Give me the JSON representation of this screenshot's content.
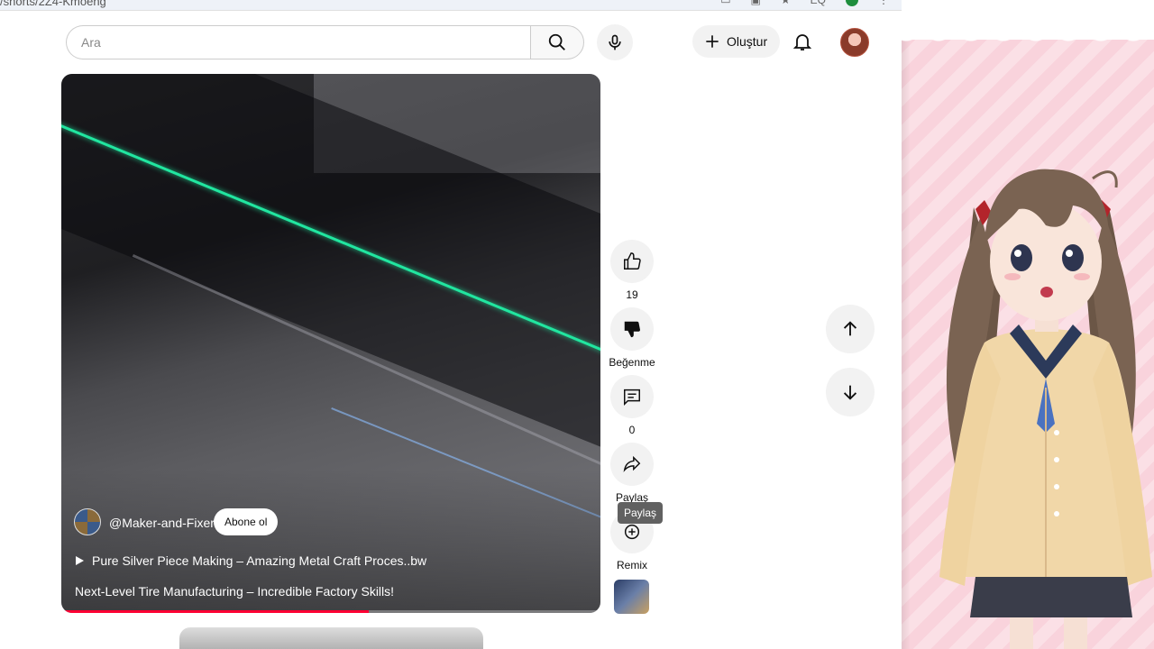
{
  "browser": {
    "url_fragment": "/shorts/2Z4-Kmoeng"
  },
  "header": {
    "search_placeholder": "Ara",
    "create_label": "Oluştur",
    "icons": [
      "search-icon",
      "mic-icon",
      "plus-icon",
      "bell-icon",
      "avatar"
    ]
  },
  "video": {
    "channel_handle": "@Maker-and-Fixer",
    "subscribe_label": "Abone ol",
    "playlist_title": "Pure Silver Piece Making – Amazing Metal Craft Proces..bw",
    "title": "Next-Level Tire Manufacturing – Incredible Factory Skills!",
    "progress_fraction": 0.57
  },
  "actions": {
    "like_count": "19",
    "dislike_label": "Beğenme",
    "comment_count": "0",
    "share_label": "Paylaş",
    "share_tooltip": "Paylaş",
    "remix_label": "Remix"
  },
  "colors": {
    "progress": "#ff0033",
    "accent_green_line": "#21e6a0"
  }
}
